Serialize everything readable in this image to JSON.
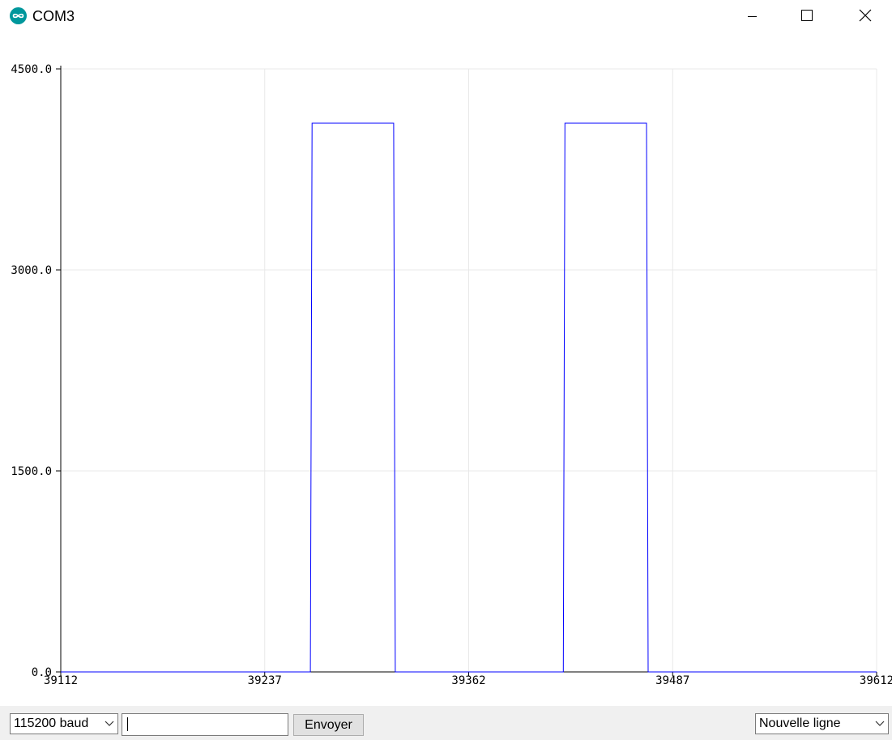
{
  "window": {
    "title": "COM3"
  },
  "chart_data": {
    "type": "line",
    "title": "",
    "xlabel": "",
    "ylabel": "",
    "x_ticks": [
      "39112",
      "39237",
      "39362",
      "39487",
      "39612"
    ],
    "y_ticks": [
      "0.0",
      "1500.0",
      "3000.0",
      "4500.0"
    ],
    "xlim": [
      39112,
      39612
    ],
    "ylim": [
      0,
      4500
    ],
    "grid": true,
    "series": [
      {
        "color": "#0000ff",
        "x": [
          39112,
          39265,
          39266,
          39316,
          39317,
          39420,
          39421,
          39471,
          39472,
          39612
        ],
        "y": [
          0,
          0,
          4095,
          4095,
          0,
          0,
          4095,
          4095,
          0,
          0
        ]
      }
    ]
  },
  "footer": {
    "baud": "115200 baud",
    "input_value": "",
    "send_label": "Envoyer",
    "line_ending": "Nouvelle ligne"
  },
  "colors": {
    "accent": "#00979c",
    "plot_line": "#0000ff",
    "grid": "#e8e8e8"
  }
}
